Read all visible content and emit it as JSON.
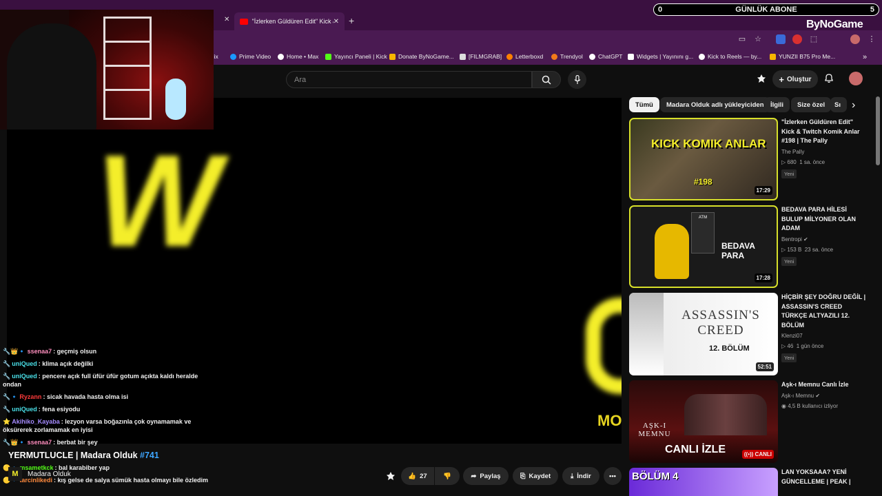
{
  "browser": {
    "active_tab_title": "\"İzlerken Güldüren Edit\" Kick &",
    "bookmarks": [
      {
        "label": "tflix",
        "color": "#e50914"
      },
      {
        "label": "Prime Video",
        "color": "#1a98ff"
      },
      {
        "label": "Home • Max",
        "color": "#ffffff"
      },
      {
        "label": "Yayıncı Paneli | Kick",
        "color": "#53fc18"
      },
      {
        "label": "Donate ByNoGame...",
        "color": "#f7b500"
      },
      {
        "label": "[FILMGRAB]",
        "color": "#dddddd"
      },
      {
        "label": "Letterboxd",
        "color": "#ff8000"
      },
      {
        "label": "Trendyol",
        "color": "#f27a1a"
      },
      {
        "label": "ChatGPT",
        "color": "#ffffff"
      },
      {
        "label": "Widgets | Yayınını g...",
        "color": "#ffffff"
      },
      {
        "label": "Kick to Reels — by...",
        "color": "#ffffff"
      },
      {
        "label": "YUNZII B75 Pro Me...",
        "color": "#f7b500"
      }
    ],
    "bookmarks_more": "»"
  },
  "overlay": {
    "abone_label": "GÜNLÜK ABONE",
    "abone_left": "0",
    "abone_right": "5",
    "brand": "ByNoGame"
  },
  "header": {
    "search_placeholder": "Ara",
    "create_label": "Oluştur"
  },
  "video": {
    "title_prefix": "YERMUTLUCLE | Madara Olduk",
    "title_hash": "#741",
    "channel_name": "Madara Olduk",
    "channel_logo": "M",
    "corner_logo": "MO"
  },
  "actions": {
    "like_count": "27",
    "share": "Paylaş",
    "save": "Kaydet",
    "download": "İndir",
    "more": "•••"
  },
  "chat": [
    {
      "name": "ssenaa7",
      "color": "#ff8fbf",
      "message": "geçmiş olsun"
    },
    {
      "name": "uniQued",
      "color": "#4ae0e8",
      "message": "klima açık değilki"
    },
    {
      "name": "uniQued",
      "color": "#4ae0e8",
      "message": "pencere açık full üfür üfür gotum açıkta kaldı heralde ondan"
    },
    {
      "name": "Ryzann",
      "color": "#ff3b3b",
      "message": "sicak havada hasta olma isi"
    },
    {
      "name": "uniQued",
      "color": "#4ae0e8",
      "message": "fena esiyodu"
    },
    {
      "name": "Akihiko_Kayaba",
      "color": "#a58bff",
      "message": "lezyon varsa boğazınla çok oynamamak ve öksürerek zorlamamak en iyisi"
    },
    {
      "name": "ssenaa7",
      "color": "#ff8fbf",
      "message": "berbat bir şey"
    },
    {
      "name": "msametkck",
      "color": "#53fc18",
      "message": "bal karabiber yap"
    },
    {
      "name": "tarcinlikedi",
      "color": "#ff8a3d",
      "message": "kış gelse de salya sümük hasta olmayı bile özledim"
    }
  ],
  "sidebar": {
    "chips": [
      "Tümü",
      "Madara Olduk adlı yükleyiciden",
      "İlgili",
      "Size özel",
      "Sı"
    ],
    "recommendations": [
      {
        "title": "\"İzlerken Güldüren Edit\" Kick & Twitch Komik Anlar #198 | The Pally",
        "channel": "The Pally",
        "views": "680",
        "age": "1 sa. önce",
        "badge": "Yeni",
        "duration": "17:29",
        "thumb_text": "KICK KOMIK ANLAR",
        "thumb_sub": "#198"
      },
      {
        "title": "BEDAVA PARA HİLESİ BULUP MİLYONER OLAN ADAM",
        "channel": "Bentropi",
        "views": "153 B",
        "age": "23 sa. önce",
        "badge": "Yeni",
        "duration": "17:28",
        "thumb_text": "BEDAVA PARA",
        "thumb_sub": "ATM"
      },
      {
        "title": "HİÇBİR ŞEY DOĞRU DEĞİL | ASSASSIN'S CREED TÜRKÇE ALTYAZILI 12. BÖLÜM",
        "channel": "Klenzi07",
        "views": "46",
        "age": "1 gün önce",
        "badge": "Yeni",
        "duration": "52:51",
        "thumb_text": "ASSASSIN'S CREED",
        "thumb_sub": "12. BÖLÜM"
      },
      {
        "title": "Aşk-ı Memnu Canlı İzle",
        "channel": "Aşk-ı Memnu",
        "views": "4,5 B kullanıcı izliyor",
        "age": "",
        "badge": "",
        "duration": "CANLI",
        "thumb_text": "CANLI İZLE",
        "thumb_sub": "AŞK-I MEMNU"
      },
      {
        "title": "LAN YOKSAAA? YENİ GÜNCELLEME | PEAK |",
        "channel": "",
        "views": "",
        "age": "",
        "badge": "",
        "duration": "",
        "thumb_text": "BÖLÜM 4",
        "thumb_sub": ""
      }
    ]
  }
}
